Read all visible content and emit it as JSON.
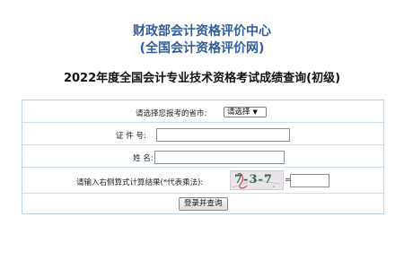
{
  "header": {
    "org_name": "财政部会计资格评价中心",
    "org_subname": "(全国会计资格评价网)",
    "query_title": "2022年度全国会计专业技术资格考试成绩查询(初级)"
  },
  "form": {
    "province_label": "请选择您报考的省市:",
    "province_select": {
      "value": "请选择"
    },
    "id_label": "证 件 号:",
    "id_value": "",
    "name_label": "姓  名:",
    "name_value": "",
    "captcha_label": "请输入右侧算式计算结果(*代表乘法):",
    "captcha_text": "7-3-7",
    "equals": "=",
    "captcha_answer": "",
    "submit_label": "登录并查询"
  }
}
